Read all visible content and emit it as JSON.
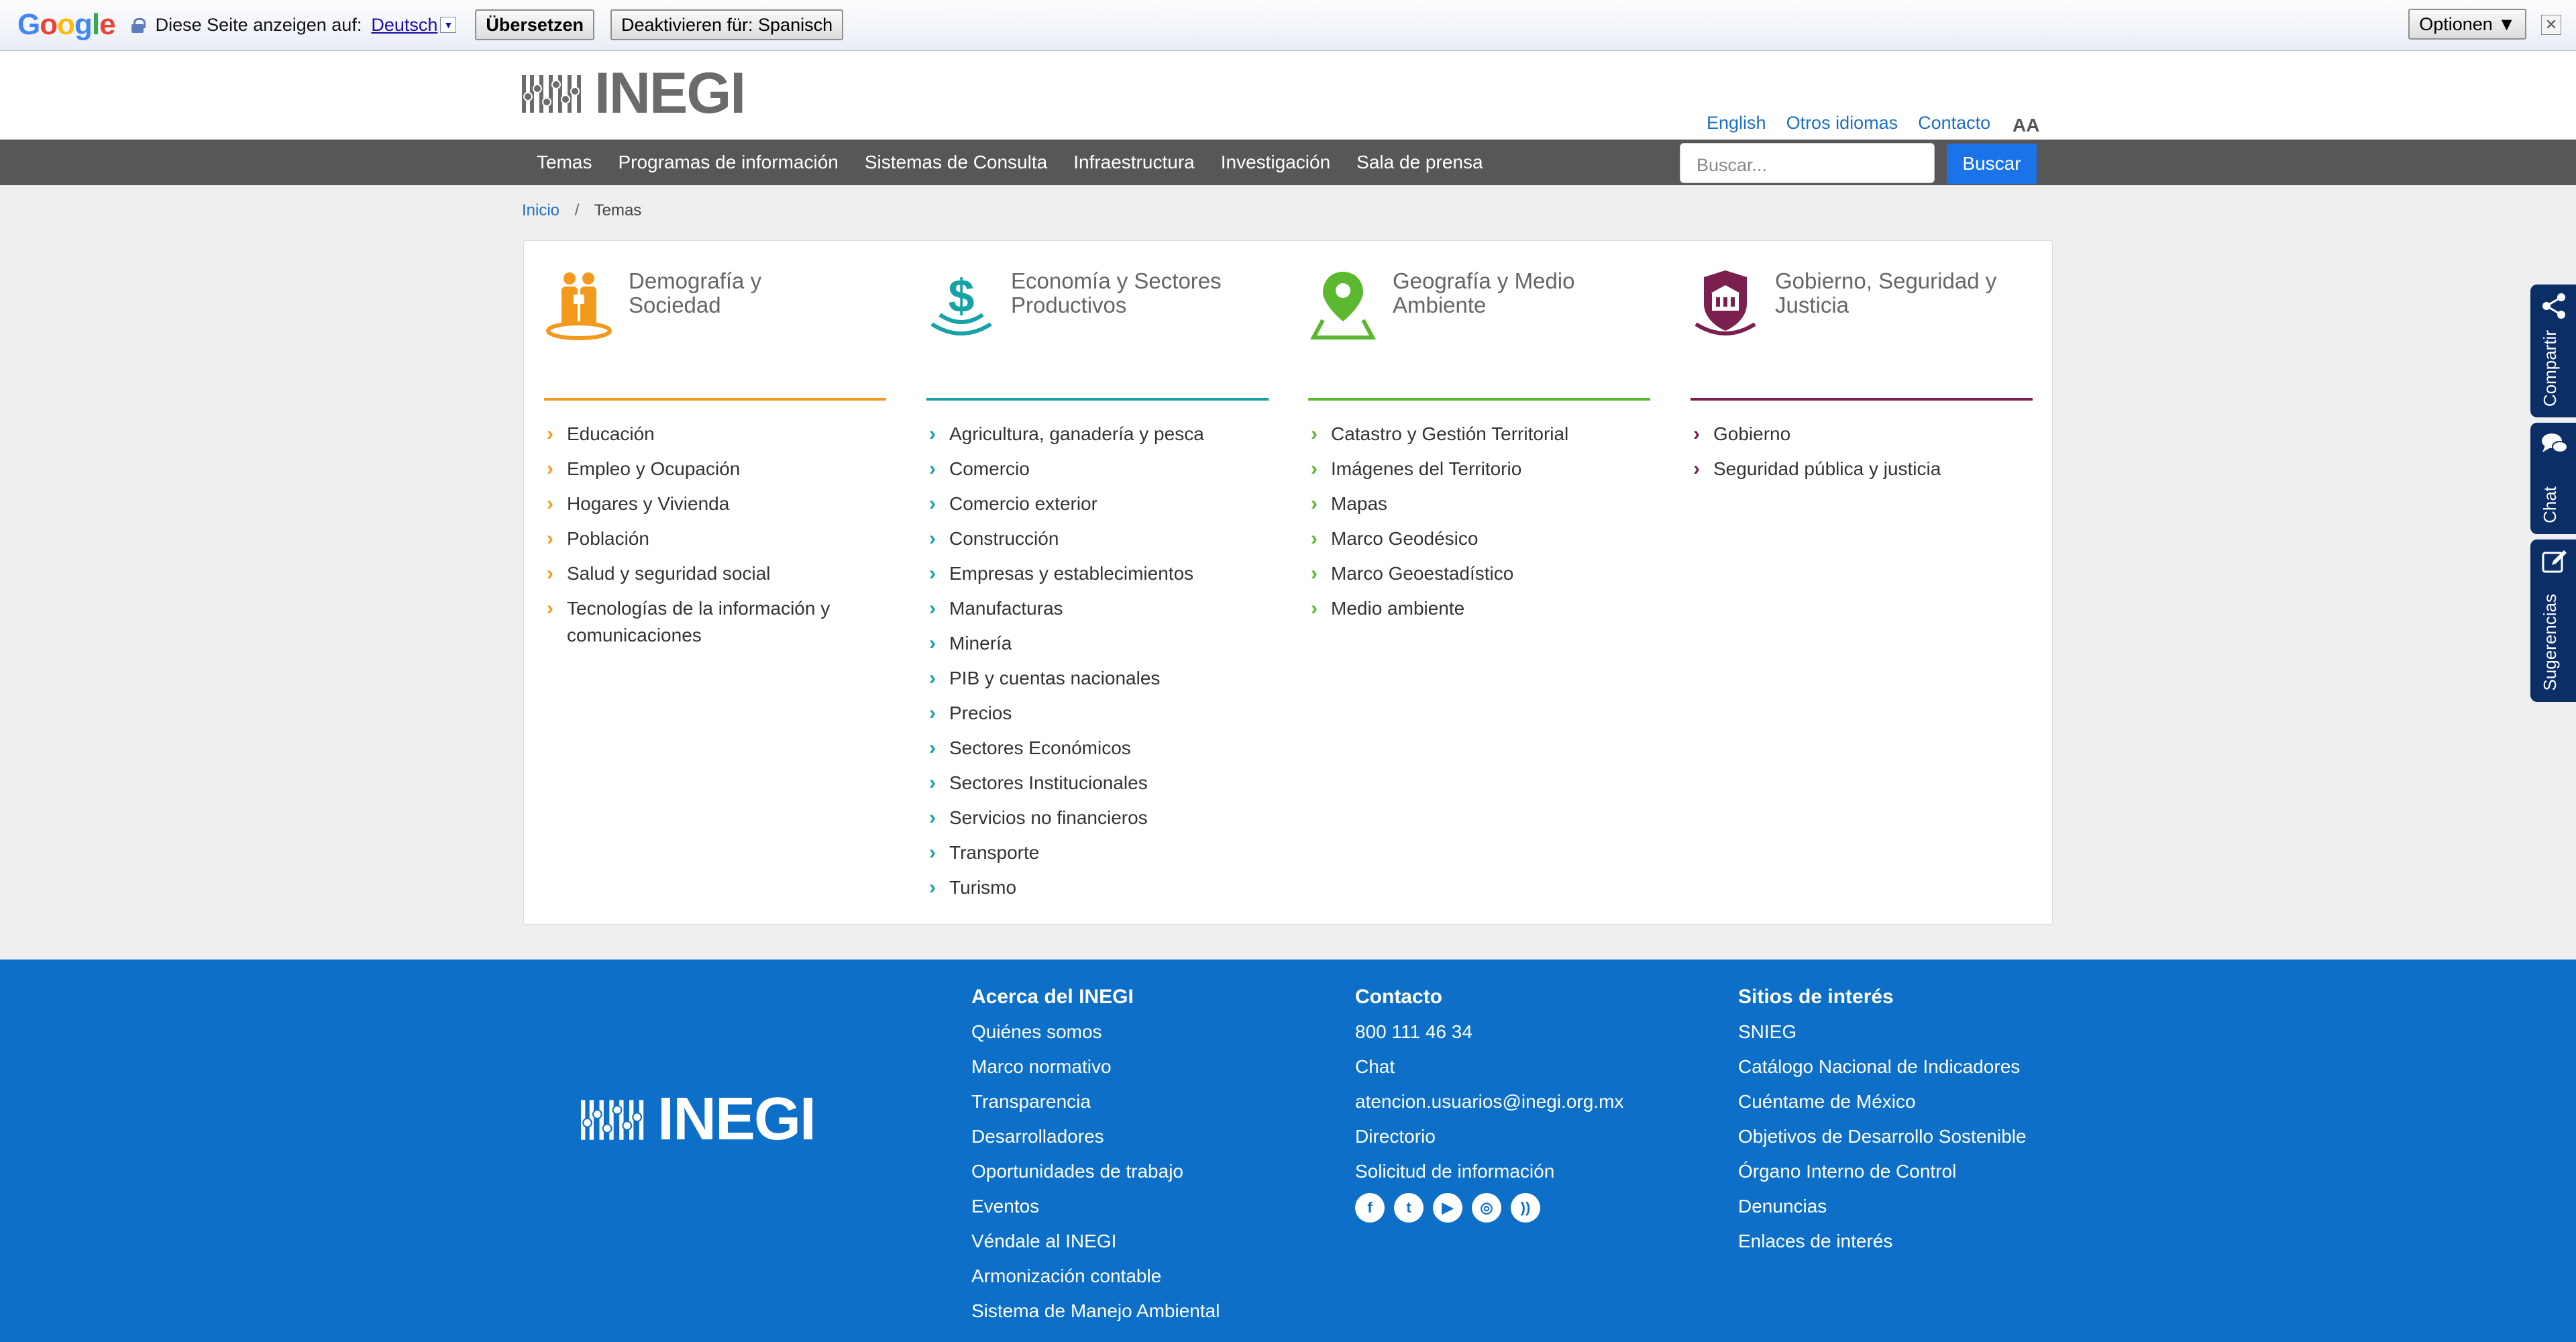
{
  "translate_bar": {
    "logo": [
      "G",
      "o",
      "o",
      "g",
      "l",
      "e"
    ],
    "prompt": "Diese Seite anzeigen auf:",
    "language": "Deutsch",
    "translate_button": "Übersetzen",
    "disable_button": "Deaktivieren für: Spanisch",
    "options_button": "Optionen ▼",
    "close": "✕"
  },
  "header": {
    "logo_text": "INEGI",
    "links": [
      "English",
      "Otros idiomas",
      "Contacto"
    ],
    "font_size_toggle": "AA"
  },
  "nav": {
    "items": [
      "Temas",
      "Programas de información",
      "Sistemas de Consulta",
      "Infraestructura",
      "Investigación",
      "Sala de prensa"
    ],
    "search_placeholder": "Buscar...",
    "search_button": "Buscar"
  },
  "breadcrumb": {
    "home": "Inicio",
    "separator": "/",
    "current": "Temas"
  },
  "categories": [
    {
      "title": "Demografía y Sociedad",
      "color": "#f39a1d",
      "icon": "people-icon",
      "items": [
        "Educación",
        "Empleo y Ocupación",
        "Hogares y Vivienda",
        "Población",
        "Salud y seguridad social",
        "Tecnologías de la información y comunicaciones"
      ]
    },
    {
      "title": "Economía y Sectores Productivos",
      "color": "#16a2a6",
      "icon": "dollar-icon",
      "items": [
        "Agricultura, ganadería y pesca",
        "Comercio",
        "Comercio exterior",
        "Construcción",
        "Empresas y establecimientos",
        "Manufacturas",
        "Minería",
        "PIB y cuentas nacionales",
        "Precios",
        "Sectores Económicos",
        "Sectores Institucionales",
        "Servicios no financieros",
        "Transporte",
        "Turismo"
      ]
    },
    {
      "title": "Geografía y Medio Ambiente",
      "color": "#5cb82e",
      "icon": "map-pin-icon",
      "items": [
        "Catastro y Gestión Territorial",
        "Imágenes del Territorio",
        "Mapas",
        "Marco Geodésico",
        "Marco Geoestadístico",
        "Medio ambiente"
      ]
    },
    {
      "title": "Gobierno, Seguridad y Justicia",
      "color": "#7a1f4e",
      "icon": "shield-building-icon",
      "items": [
        "Gobierno",
        "Seguridad pública y justicia"
      ]
    }
  ],
  "footer": {
    "logo_text": "INEGI",
    "about": {
      "title": "Acerca del INEGI",
      "items": [
        "Quiénes somos",
        "Marco normativo",
        "Transparencia",
        "Desarrolladores",
        "Oportunidades de trabajo",
        "Eventos",
        "Véndale al INEGI",
        "Armonización contable",
        "Sistema de Manejo Ambiental"
      ]
    },
    "contact": {
      "title": "Contacto",
      "items": [
        "800 111 46 34",
        "Chat",
        "atencion.usuarios@inegi.org.mx",
        "Directorio",
        "Solicitud de información"
      ],
      "social": [
        "facebook-icon",
        "twitter-icon",
        "youtube-icon",
        "instagram-icon",
        "rss-icon"
      ]
    },
    "sites": {
      "title": "Sitios de interés",
      "items": [
        "SNIEG",
        "Catálogo Nacional de Indicadores",
        "Cuéntame de México",
        "Objetivos de Desarrollo Sostenible",
        "Órgano Interno de Control",
        "Denuncias",
        "Enlaces de interés"
      ]
    }
  },
  "side_tabs": [
    "Compartir",
    "Chat",
    "Sugerencias"
  ]
}
